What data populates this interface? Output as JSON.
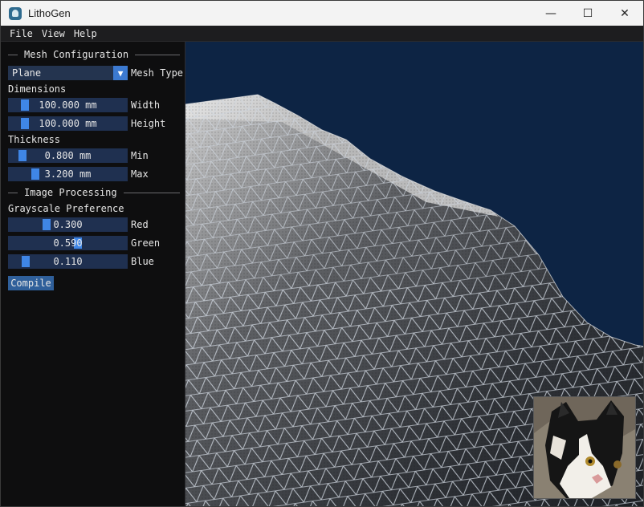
{
  "window": {
    "title": "LithoGen",
    "controls": {
      "minimize": "—",
      "maximize": "☐",
      "close": "✕"
    }
  },
  "menu": [
    "File",
    "View",
    "Help"
  ],
  "panel": {
    "mesh_section": "Mesh Configuration",
    "mesh_type": {
      "value": "Plane",
      "label": "Mesh Type"
    },
    "dimensions": {
      "heading": "Dimensions",
      "width": {
        "value": "100.000 mm",
        "label": "Width",
        "level": 0.1
      },
      "height": {
        "value": "100.000 mm",
        "label": "Height",
        "level": 0.1
      }
    },
    "thickness": {
      "heading": "Thickness",
      "min": {
        "value": "0.800 mm",
        "label": "Min",
        "level": 0.08
      },
      "max": {
        "value": "3.200 mm",
        "label": "Max",
        "level": 0.2
      }
    },
    "image_section": "Image Processing",
    "grayscale": {
      "heading": "Grayscale Preference",
      "red": {
        "value": "0.300",
        "label": "Red",
        "level": 0.3
      },
      "green": {
        "value": "0.590",
        "label": "Green",
        "level": 0.59
      },
      "blue": {
        "value": "0.110",
        "label": "Blue",
        "level": 0.11
      }
    },
    "compile_label": "Compile"
  },
  "colors": {
    "accent": "#3f86e6",
    "frame": "#1f3050",
    "viewport_bg": "#0d2444"
  }
}
